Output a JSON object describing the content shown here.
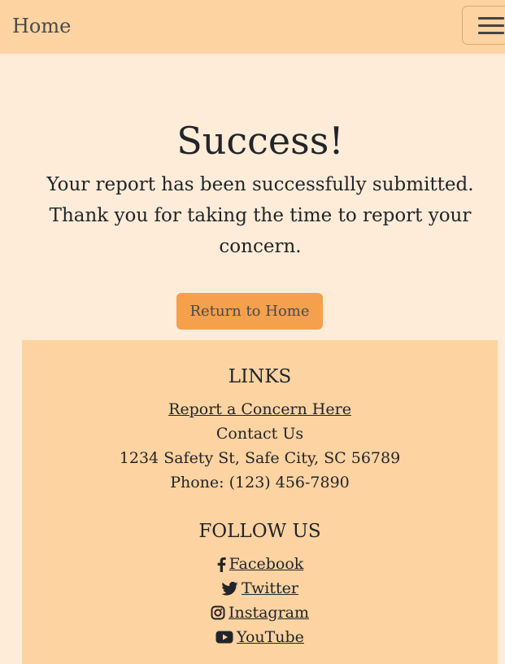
{
  "navbar": {
    "brand": "Home",
    "toggle_icon": "hamburger-icon"
  },
  "main": {
    "title": "Success!",
    "message": "Your report has been successfully submitted. Thank you for taking the time to report your concern.",
    "button_label": "Return to Home"
  },
  "footer": {
    "links_heading": "LINKS",
    "report_link": "Report a Concern Here",
    "contact": "Contact Us",
    "address": "1234 Safety St, Safe City, SC 56789",
    "phone": "Phone: (123) 456-7890",
    "follow_heading": "FOLLOW US",
    "social": [
      {
        "label": " Facebook",
        "icon": "facebook-icon"
      },
      {
        "label": " Twitter",
        "icon": "twitter-icon"
      },
      {
        "label": " Instagram",
        "icon": "instagram-icon"
      },
      {
        "label": " YouTube",
        "icon": "youtube-icon"
      }
    ]
  },
  "colors": {
    "page_bg": "#ffecd8",
    "nav_bg": "#fdd3a1",
    "button_bg": "#f4a04d",
    "text": "#212529"
  }
}
